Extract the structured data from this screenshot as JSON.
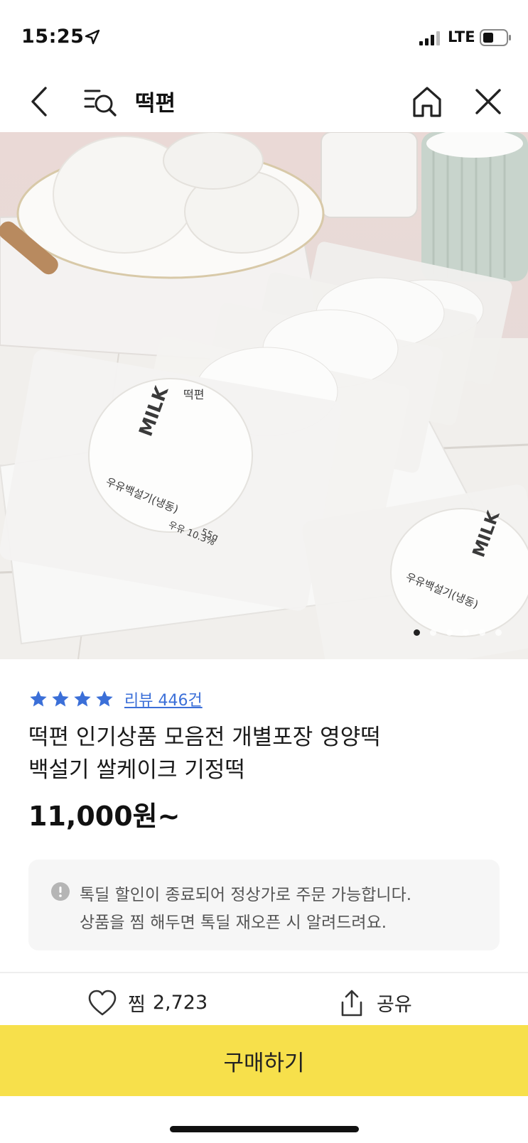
{
  "status_bar": {
    "time": "15:25",
    "network": "LTE"
  },
  "nav": {
    "title": "떡편",
    "icons": [
      "back-icon",
      "search-list-icon",
      "home-icon",
      "close-icon"
    ]
  },
  "product": {
    "image_alt": "",
    "image_packaging_text": [
      "MILK",
      "떡편",
      "우유백설기(냉동)",
      "55g",
      "우유 10.3%"
    ],
    "rating_stars": 4,
    "review_link": "리뷰 446건",
    "title_line1": "떡편 인기상품 모음전 개별포장 영양떡",
    "title_line2": "백설기 쌀케이크 기정떡",
    "price": "11,000원~"
  },
  "carousel": {
    "total": 6,
    "active": 0
  },
  "notice": {
    "line1": "톡딜 할인이 종료되어 정상가로 주문 가능합니다.",
    "line2": "상품을 찜 해두면 톡딜 재오픈 시 알려드려요."
  },
  "actions": {
    "wish_label": "찜",
    "wish_count": "2,723",
    "share_label": "공유"
  },
  "buy_button": "구매하기",
  "colors": {
    "buy_bar": "#f7e04b",
    "star": "#3b6fd8",
    "link": "#3b6fd8"
  }
}
